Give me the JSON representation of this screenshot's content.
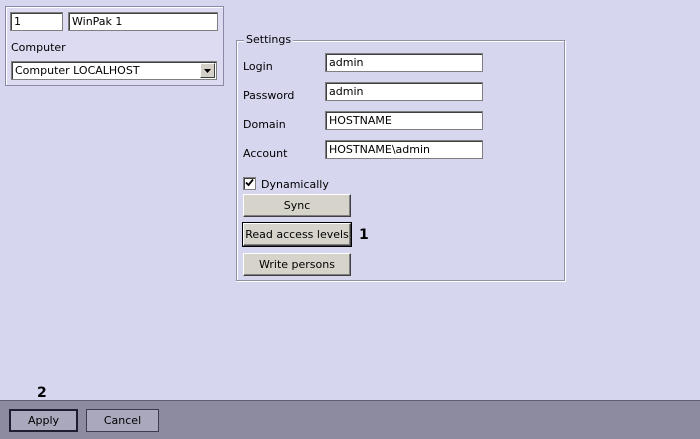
{
  "object": {
    "id": "1",
    "name": "WinPak 1",
    "computer_label": "Computer",
    "computer_value": "Computer LOCALHOST"
  },
  "settings": {
    "group_title": "Settings",
    "login_label": "Login",
    "login_value": "admin",
    "password_label": "Password",
    "password_value": "admin",
    "domain_label": "Domain",
    "domain_value": "HOSTNAME",
    "account_label": "Account",
    "account_value": "HOSTNAME\\admin",
    "dynamically_label": "Dynamically",
    "dynamically_checked": true,
    "sync_label": "Sync",
    "read_access_levels_label": "Read access levels",
    "write_persons_label": "Write persons"
  },
  "annotations": {
    "marker_1": "1",
    "marker_2": "2"
  },
  "footer": {
    "apply_label": "Apply",
    "cancel_label": "Cancel"
  }
}
